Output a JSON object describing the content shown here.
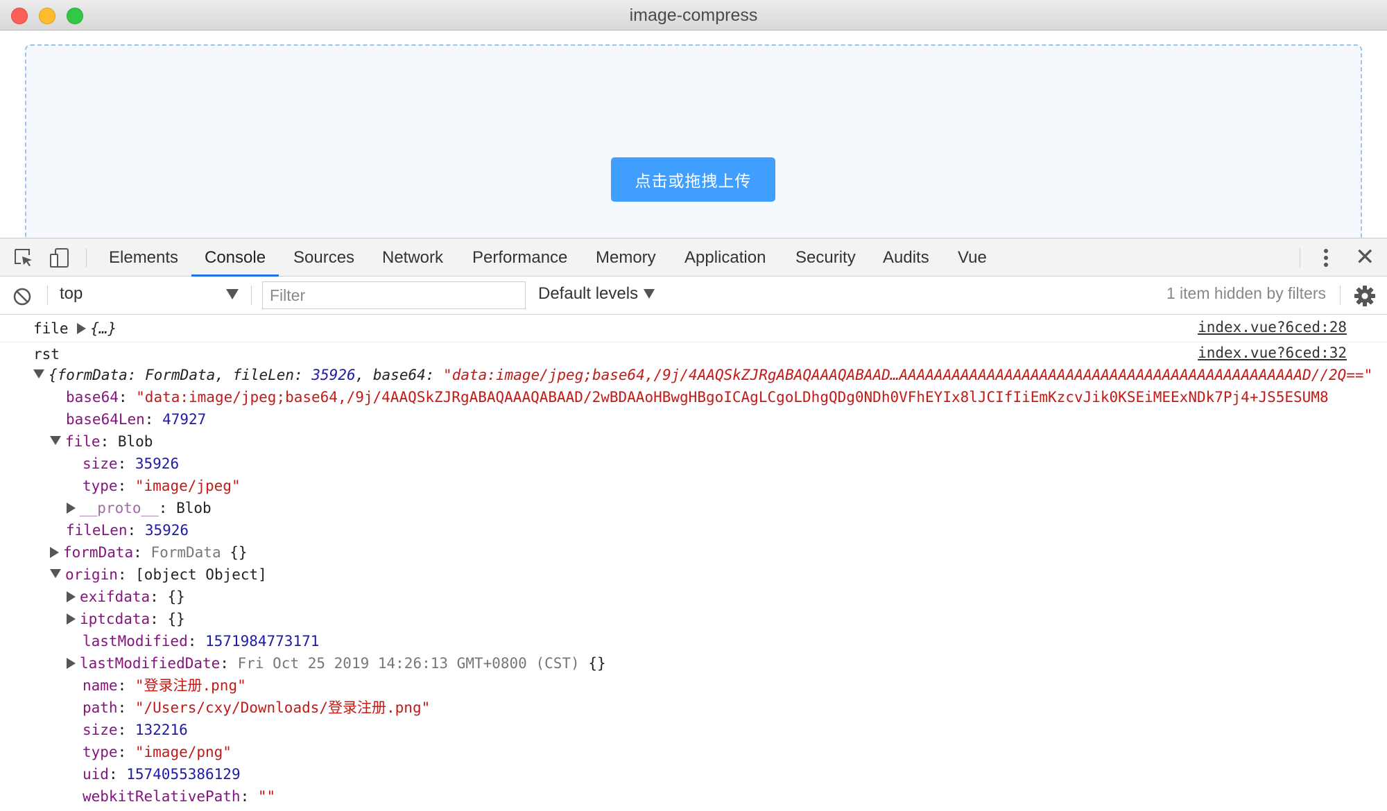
{
  "window": {
    "title": "image-compress"
  },
  "page": {
    "upload_button": "点击或拖拽上传"
  },
  "devtools": {
    "tabs": [
      "Elements",
      "Console",
      "Sources",
      "Network",
      "Performance",
      "Memory",
      "Application",
      "Security",
      "Audits",
      "Vue"
    ],
    "active_tab": "Console",
    "context": "top",
    "filter_placeholder": "Filter",
    "levels": "Default levels",
    "hidden_note": "1 item hidden by filters"
  },
  "console": {
    "msg1": {
      "label": "file",
      "preview": "{…}",
      "source": "index.vue?6ced:28"
    },
    "msg2": {
      "label": "rst",
      "source": "index.vue?6ced:32",
      "summary": {
        "k1": "formData",
        "v1": "FormData",
        "k2": "fileLen",
        "v2": "35926",
        "k3": "base64",
        "v3": "\"data:image/jpeg;base64,/9j/4AAQSkZJRgABAQAAAQABAAD…AAAAAAAAAAAAAAAAAAAAAAAAAAAAAAAAAAAAAAAAAAAAAAD//2Q==\""
      },
      "base64": {
        "key": "base64",
        "value": "\"data:image/jpeg;base64,/9j/4AAQSkZJRgABAQAAAQABAAD/2wBDAAoHBwgHBgoICAgLCgoLDhgQDg0NDh0VFhEYIx8lJCIfIiEmKzcvJik0KSEiMEExNDk7Pj4+JS5ESUM8"
      },
      "base64Len": {
        "key": "base64Len",
        "value": "47927"
      },
      "file": {
        "key": "file",
        "type": "Blob",
        "size": {
          "key": "size",
          "value": "35926"
        },
        "mime": {
          "key": "type",
          "value": "\"image/jpeg\""
        },
        "proto": {
          "key": "__proto__",
          "value": "Blob"
        }
      },
      "fileLen": {
        "key": "fileLen",
        "value": "35926"
      },
      "formData": {
        "key": "formData",
        "value": "FormData",
        "braces": "{}"
      },
      "origin": {
        "key": "origin",
        "type": {
          "key": "type",
          "value": "\"image/png\""
        },
        "exifdata": {
          "key": "exifdata",
          "value": "{}"
        },
        "iptcdata": {
          "key": "iptcdata",
          "value": "{}"
        },
        "lastModified": {
          "key": "lastModified",
          "value": "1571984773171"
        },
        "lastModifiedDate": {
          "key": "lastModifiedDate",
          "value": "Fri Oct 25 2019 14:26:13 GMT+0800 (CST)",
          "braces": "{}"
        },
        "name": {
          "key": "name",
          "value": "\"登录注册.png\""
        },
        "path": {
          "key": "path",
          "value": "\"/Users/cxy/Downloads/登录注册.png\""
        },
        "size": {
          "key": "size",
          "value": "132216"
        },
        "uid": {
          "key": "uid",
          "value": "1574055386129"
        },
        "webkitRelativePath": {
          "key": "webkitRelativePath",
          "value": "\"\""
        }
      }
    }
  }
}
